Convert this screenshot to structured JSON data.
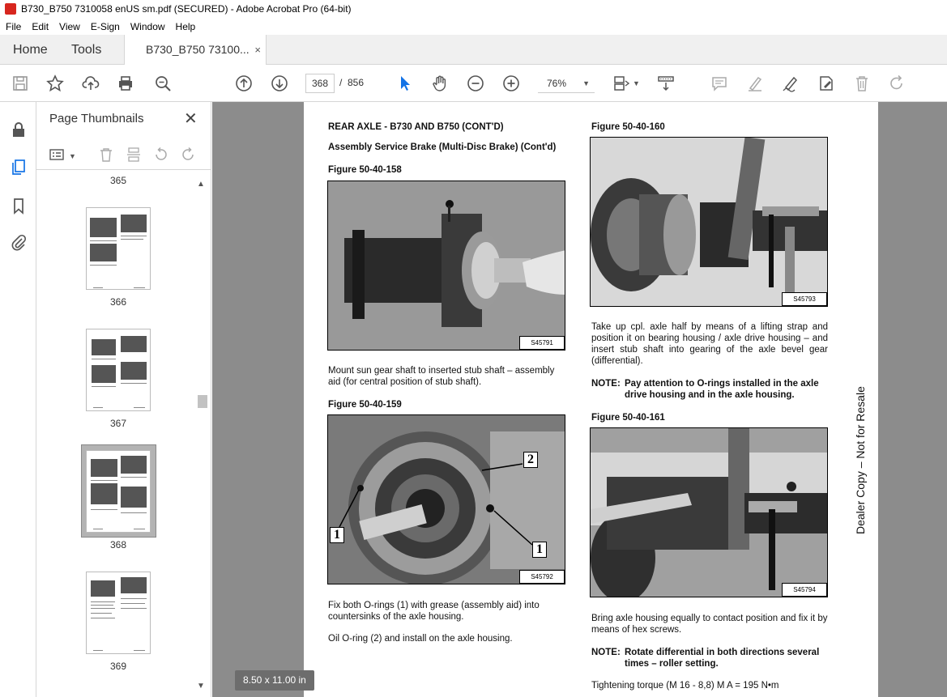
{
  "window": {
    "title": "B730_B750 7310058 enUS sm.pdf (SECURED) - Adobe Acrobat Pro (64-bit)"
  },
  "menu": [
    "File",
    "Edit",
    "View",
    "E-Sign",
    "Window",
    "Help"
  ],
  "tabs": {
    "home": "Home",
    "tools": "Tools",
    "document": "B730_B750 73100...",
    "close": "×"
  },
  "toolbar": {
    "page_current": "368",
    "page_sep": "/",
    "page_total": "856",
    "zoom": "76%",
    "icons": [
      "save-icon",
      "star-icon",
      "upload-icon",
      "print-icon",
      "zoom-search-icon",
      "prev-page-icon",
      "next-page-icon",
      "select-arrow-icon",
      "hand-icon",
      "zoom-out-icon",
      "zoom-in-icon",
      "fit-page-icon",
      "scroll-mode-icon",
      "comment-icon",
      "highlight-icon",
      "sign-icon",
      "fill-sign-icon",
      "delete-icon",
      "redo-icon"
    ]
  },
  "thumbnails_panel": {
    "title": "Page Thumbnails",
    "close": "✕",
    "pages": [
      "365",
      "366",
      "367",
      "368",
      "369"
    ],
    "selected": "368"
  },
  "document": {
    "heading": "REAR AXLE - B730 AND B750 (CONT'D)",
    "subheading": "Assembly Service Brake (Multi-Disc Brake) (Cont'd)",
    "fig158_title": "Figure 50-40-158",
    "fig158_id": "S45791",
    "fig158_text": "Mount sun gear shaft to inserted stub shaft – assembly aid (for central position of stub shaft).",
    "fig159_title": "Figure 50-40-159",
    "fig159_id": "S45792",
    "fig159_callouts": [
      "2",
      "1",
      "1"
    ],
    "fig159_text1": "Fix both O-rings (1) with grease (assembly aid) into countersinks of the axle housing.",
    "fig159_text2": "Oil O-ring (2) and install on the axle housing.",
    "fig160_title": "Figure 50-40-160",
    "fig160_id": "S45793",
    "fig160_text": "Take up cpl. axle half by means of a lifting strap and position it on bearing housing / axle drive housing – and insert stub shaft into gearing of the axle bevel gear (differential).",
    "note1_label": "NOTE:",
    "note1_text": "Pay attention to O-rings installed in the axle drive housing and in the axle housing.",
    "fig161_title": "Figure 50-40-161",
    "fig161_id": "S45794",
    "fig161_text": "Bring axle housing equally to contact position and fix it by means of hex screws.",
    "note2_label": "NOTE:",
    "note2_text": "Rotate differential in both directions several times – roller setting.",
    "torque_text": "Tightening torque (M 16 - 8,8) M A = 195 N•m",
    "side_text": "Dealer Copy – Not for Resale"
  },
  "page_size": "8.50 x 11.00 in"
}
